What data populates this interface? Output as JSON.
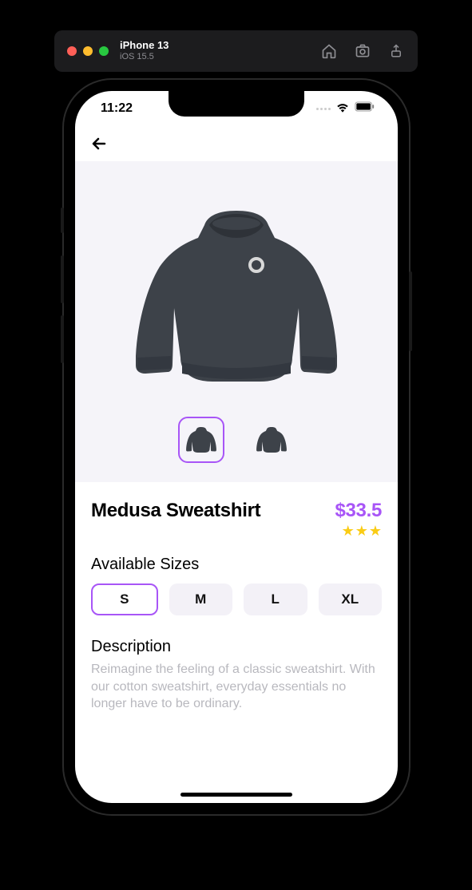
{
  "simulator": {
    "device": "iPhone 13",
    "os": "iOS 15.5",
    "icons": [
      "home-icon",
      "screenshot-icon",
      "share-icon"
    ]
  },
  "status": {
    "time": "11:22"
  },
  "product": {
    "title": "Medusa Sweatshirt",
    "price": "$33.5",
    "rating": 3,
    "sizes_label": "Available Sizes",
    "sizes": [
      {
        "label": "S",
        "selected": true
      },
      {
        "label": "M",
        "selected": false
      },
      {
        "label": "L",
        "selected": false
      },
      {
        "label": "XL",
        "selected": false
      }
    ],
    "description_label": "Description",
    "description": "Reimagine the feeling of a classic sweatshirt. With our cotton sweatshirt, everyday essentials no longer have to be ordinary.",
    "thumbnails": [
      {
        "selected": true
      },
      {
        "selected": false
      }
    ]
  },
  "colors": {
    "accent": "#a855f7",
    "star": "#facc15"
  }
}
